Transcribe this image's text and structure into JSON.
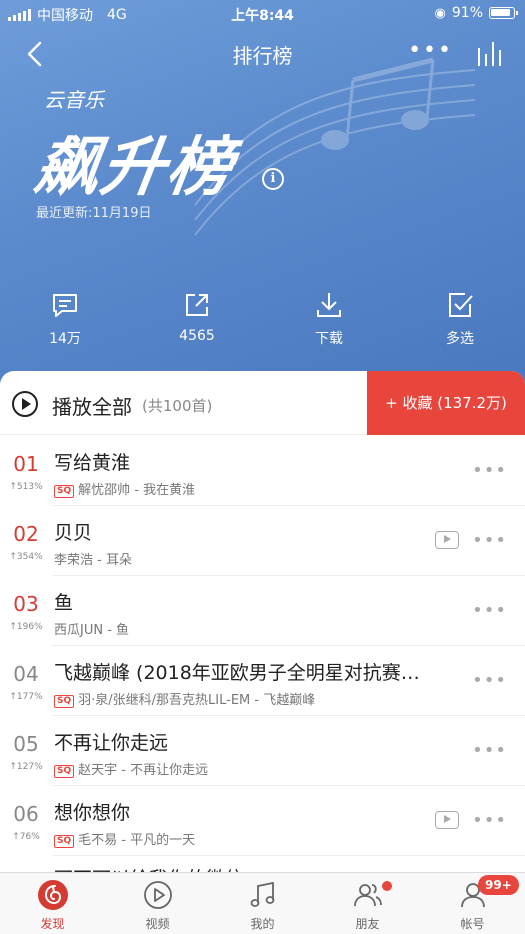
{
  "status_bar": {
    "carrier": "中国移动",
    "network": "4G",
    "time": "上午8:44",
    "battery": "91%"
  },
  "nav": {
    "title": "排行榜"
  },
  "chart": {
    "brand": "云音乐",
    "name": "飙升榜",
    "updated": "最近更新:11月19日"
  },
  "actions": {
    "comments": "14万",
    "share": "4565",
    "download": "下载",
    "multi_select": "多选"
  },
  "play_all": {
    "label": "播放全部",
    "count": "(共100首)",
    "collect": "+ 收藏 (137.2万)"
  },
  "songs": [
    {
      "rank": "01",
      "trend": "↑513%",
      "title": "写给黄淮",
      "sq": true,
      "artist_album": "解忧邵帅 - 我在黄淮",
      "mv": false
    },
    {
      "rank": "02",
      "trend": "↑354%",
      "title": "贝贝",
      "sq": false,
      "artist_album": "李荣浩 - 耳朵",
      "mv": true
    },
    {
      "rank": "03",
      "trend": "↑196%",
      "title": "鱼",
      "sq": false,
      "artist_album": "西瓜JUN - 鱼",
      "mv": false
    },
    {
      "rank": "04",
      "trend": "↑177%",
      "title": "飞越巅峰 (2018年亚欧男子全明星对抗赛…",
      "sq": true,
      "artist_album": "羽·泉/张继科/那吾克热LIL-EM - 飞越巅峰",
      "mv": false
    },
    {
      "rank": "05",
      "trend": "↑127%",
      "title": "不再让你走远",
      "sq": true,
      "artist_album": "赵天宇 - 不再让你走远",
      "mv": false
    },
    {
      "rank": "06",
      "trend": "↑76%",
      "title": "想你想你",
      "sq": true,
      "artist_album": "毛不易 - 平凡的一天",
      "mv": true
    }
  ],
  "partial_song_title": "可不可以给我你的微信",
  "sq_label": "SQ",
  "tabs": {
    "discover": "发现",
    "video": "视频",
    "mine": "我的",
    "friends": "朋友",
    "account": "帐号",
    "account_badge": "99+"
  },
  "colors": {
    "accent": "#d43c33",
    "header_blue": "#5a89cc"
  }
}
